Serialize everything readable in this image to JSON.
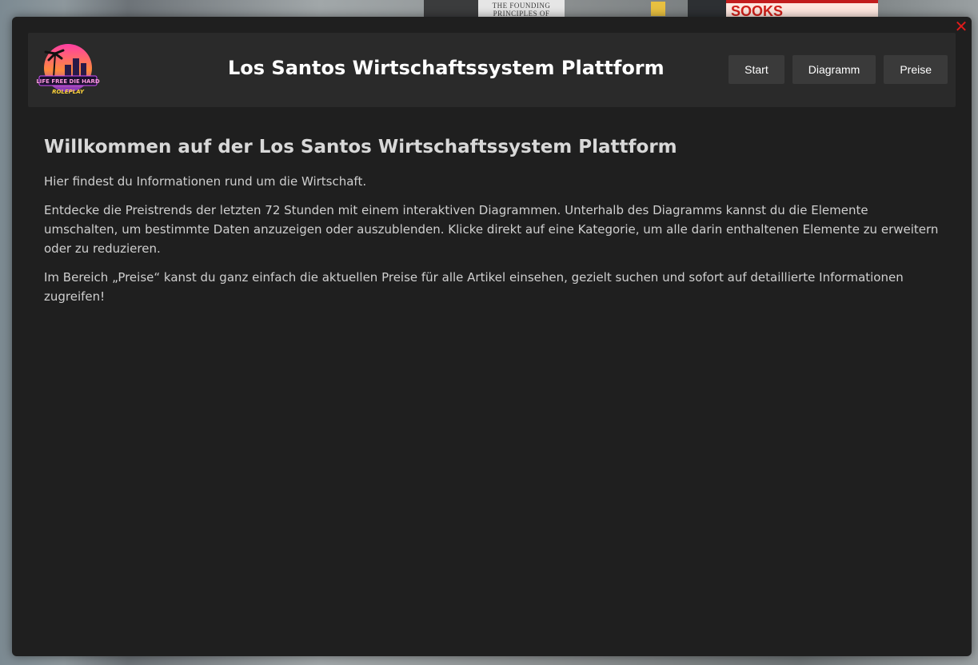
{
  "background": {
    "sign_text": "THE FOUNDING PRINCIPLES OF HAPPINESS",
    "billboard_text": "SOOKS"
  },
  "window": {
    "close_symbol": "✕",
    "close_color": "#e01b1b",
    "background_color": "#1f1f1f"
  },
  "header": {
    "logo": {
      "line1": "LIFE FREE DIE HARD",
      "line2": "ROLEPLAY",
      "icon": "palm-city-sunset-logo"
    },
    "title": "Los Santos Wirtschaftssystem Plattform",
    "nav": [
      {
        "label": "Start"
      },
      {
        "label": "Diagramm"
      },
      {
        "label": "Preise"
      }
    ]
  },
  "main": {
    "heading": "Willkommen auf der Los Santos Wirtschaftssystem Plattform",
    "paragraphs": [
      "Hier findest du Informationen rund um die Wirtschaft.",
      "Entdecke die Preistrends der letzten 72 Stunden mit einem interaktiven Diagrammen. Unterhalb des Diagramms kannst du die Elemente umschalten, um bestimmte Daten anzuzeigen oder auszublenden. Klicke direkt auf eine Kategorie, um alle darin enthaltenen Elemente zu erweitern oder zu reduzieren.",
      "Im Bereich „Preise“ kanst du ganz einfach die aktuellen Preise für alle Artikel einsehen, gezielt suchen und sofort auf detaillierte Informationen zugreifen!"
    ]
  }
}
